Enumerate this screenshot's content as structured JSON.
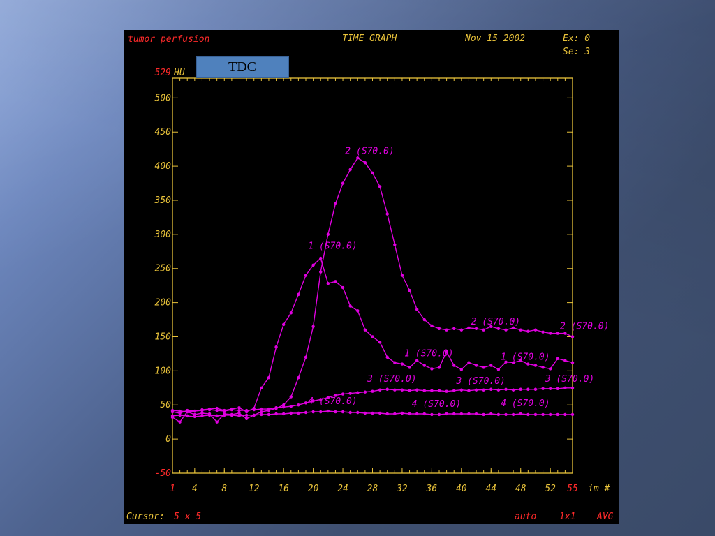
{
  "header": {
    "study": "tumor perfusion",
    "mode": "TIME GRAPH",
    "date": "Nov 15 2002",
    "exam": "Ex: 0",
    "series": "Se: 3"
  },
  "badge": {
    "label": "TDC"
  },
  "footer": {
    "cursor_label": "Cursor:",
    "cursor_value": "5 x 5",
    "scale": "auto",
    "zoom": "1x1",
    "mode": "AVG"
  },
  "colors": {
    "axis": "#e8c23a",
    "accent_red": "#ff2a2a",
    "series": "#e000e0",
    "background": "#000000",
    "badge": "#4f81bd"
  },
  "chart_data": {
    "type": "line",
    "title": "TIME GRAPH",
    "ylabel": "HU",
    "xlabel": "im #",
    "xlim": [
      1,
      55
    ],
    "ylim": [
      -50,
      529
    ],
    "y_max_label": "529",
    "x_min_label": "1",
    "x_max_label": "55",
    "x_ticks": [
      "1",
      "4",
      "8",
      "12",
      "16",
      "20",
      "24",
      "28",
      "32",
      "36",
      "40",
      "44",
      "48",
      "52",
      "55"
    ],
    "y_ticks": [
      "-50",
      "0",
      "50",
      "100",
      "150",
      "200",
      "250",
      "300",
      "350",
      "400",
      "450",
      "500"
    ],
    "grid": false,
    "series": [
      {
        "name": "1 (S70.0)",
        "labels": [
          {
            "x": 21,
            "y": 273,
            "text": "1 (S70.0)"
          },
          {
            "x": 34,
            "y": 115,
            "text": "1 (S70.0)"
          },
          {
            "x": 47,
            "y": 110,
            "text": "1 (S70.0)"
          }
        ],
        "x": [
          1,
          2,
          3,
          4,
          5,
          6,
          7,
          8,
          9,
          10,
          11,
          12,
          13,
          14,
          15,
          16,
          17,
          18,
          19,
          20,
          21,
          22,
          23,
          24,
          25,
          26,
          27,
          28,
          29,
          30,
          31,
          32,
          33,
          34,
          35,
          36,
          37,
          38,
          39,
          40,
          41,
          42,
          43,
          44,
          45,
          46,
          47,
          48,
          49,
          50,
          51,
          52,
          53,
          54,
          55
        ],
        "values": [
          40,
          38,
          42,
          41,
          43,
          44,
          45,
          42,
          44,
          46,
          40,
          45,
          75,
          90,
          135,
          168,
          185,
          212,
          240,
          255,
          265,
          228,
          231,
          222,
          195,
          188,
          160,
          150,
          142,
          120,
          112,
          110,
          105,
          115,
          108,
          103,
          105,
          128,
          108,
          102,
          112,
          108,
          105,
          108,
          102,
          113,
          112,
          115,
          110,
          108,
          105,
          103,
          118,
          115,
          112
        ]
      },
      {
        "name": "2 (S70.0)",
        "labels": [
          {
            "x": 26,
            "y": 412,
            "text": "2 (S70.0)"
          },
          {
            "x": 43,
            "y": 162,
            "text": "2 (S70.0)"
          },
          {
            "x": 55,
            "y": 155,
            "text": "2 (S70.0)"
          }
        ],
        "x": [
          1,
          2,
          3,
          4,
          5,
          6,
          7,
          8,
          9,
          10,
          11,
          12,
          13,
          14,
          15,
          16,
          17,
          18,
          19,
          20,
          21,
          22,
          23,
          24,
          25,
          26,
          27,
          28,
          29,
          30,
          31,
          32,
          33,
          34,
          35,
          36,
          37,
          38,
          39,
          40,
          41,
          42,
          43,
          44,
          45,
          46,
          47,
          48,
          49,
          50,
          51,
          52,
          53,
          54,
          55
        ],
        "values": [
          32,
          25,
          40,
          36,
          38,
          37,
          25,
          37,
          36,
          38,
          30,
          35,
          40,
          42,
          45,
          50,
          62,
          90,
          120,
          165,
          245,
          300,
          345,
          375,
          395,
          412,
          405,
          390,
          370,
          330,
          285,
          240,
          218,
          190,
          175,
          166,
          162,
          160,
          162,
          160,
          163,
          162,
          160,
          165,
          162,
          160,
          163,
          160,
          158,
          160,
          157,
          155,
          155,
          155,
          150
        ]
      },
      {
        "name": "3 (S70.0)",
        "labels": [
          {
            "x": 29,
            "y": 78,
            "text": "3 (S70.0)"
          },
          {
            "x": 41,
            "y": 75,
            "text": "3 (S70.0)"
          },
          {
            "x": 53,
            "y": 78,
            "text": "3 (S70.0)"
          }
        ],
        "x": [
          1,
          2,
          3,
          4,
          5,
          6,
          7,
          8,
          9,
          10,
          11,
          12,
          13,
          14,
          15,
          16,
          17,
          18,
          19,
          20,
          21,
          22,
          23,
          24,
          25,
          26,
          27,
          28,
          29,
          30,
          31,
          32,
          33,
          34,
          35,
          36,
          37,
          38,
          39,
          40,
          41,
          42,
          43,
          44,
          45,
          46,
          47,
          48,
          49,
          50,
          51,
          52,
          53,
          54,
          55
        ],
        "values": [
          42,
          41,
          40,
          41,
          42,
          43,
          42,
          41,
          43,
          42,
          42,
          43,
          44,
          44,
          46,
          47,
          48,
          50,
          53,
          56,
          58,
          61,
          64,
          66,
          67,
          68,
          69,
          70,
          72,
          73,
          72,
          72,
          71,
          72,
          71,
          71,
          71,
          70,
          71,
          72,
          71,
          72,
          72,
          73,
          72,
          73,
          72,
          73,
          73,
          73,
          74,
          74,
          74,
          75,
          75
        ]
      },
      {
        "name": "4 (S70.0)",
        "labels": [
          {
            "x": 21,
            "y": 45,
            "text": "4 (S70.0)"
          },
          {
            "x": 35,
            "y": 41,
            "text": "4 (S70.0)"
          },
          {
            "x": 47,
            "y": 42,
            "text": "4 (S70.0)"
          }
        ],
        "x": [
          1,
          2,
          3,
          4,
          5,
          6,
          7,
          8,
          9,
          10,
          11,
          12,
          13,
          14,
          15,
          16,
          17,
          18,
          19,
          20,
          21,
          22,
          23,
          24,
          25,
          26,
          27,
          28,
          29,
          30,
          31,
          32,
          33,
          34,
          35,
          36,
          37,
          38,
          39,
          40,
          41,
          42,
          43,
          44,
          45,
          46,
          47,
          48,
          49,
          50,
          51,
          52,
          53,
          54,
          55
        ],
        "values": [
          34,
          35,
          34,
          33,
          34,
          35,
          34,
          35,
          35,
          34,
          35,
          35,
          36,
          36,
          37,
          37,
          38,
          38,
          39,
          40,
          40,
          41,
          40,
          40,
          39,
          39,
          38,
          38,
          38,
          37,
          37,
          38,
          37,
          37,
          37,
          36,
          36,
          37,
          37,
          37,
          37,
          37,
          36,
          37,
          36,
          36,
          36,
          37,
          36,
          36,
          36,
          36,
          36,
          36,
          36
        ]
      }
    ]
  }
}
